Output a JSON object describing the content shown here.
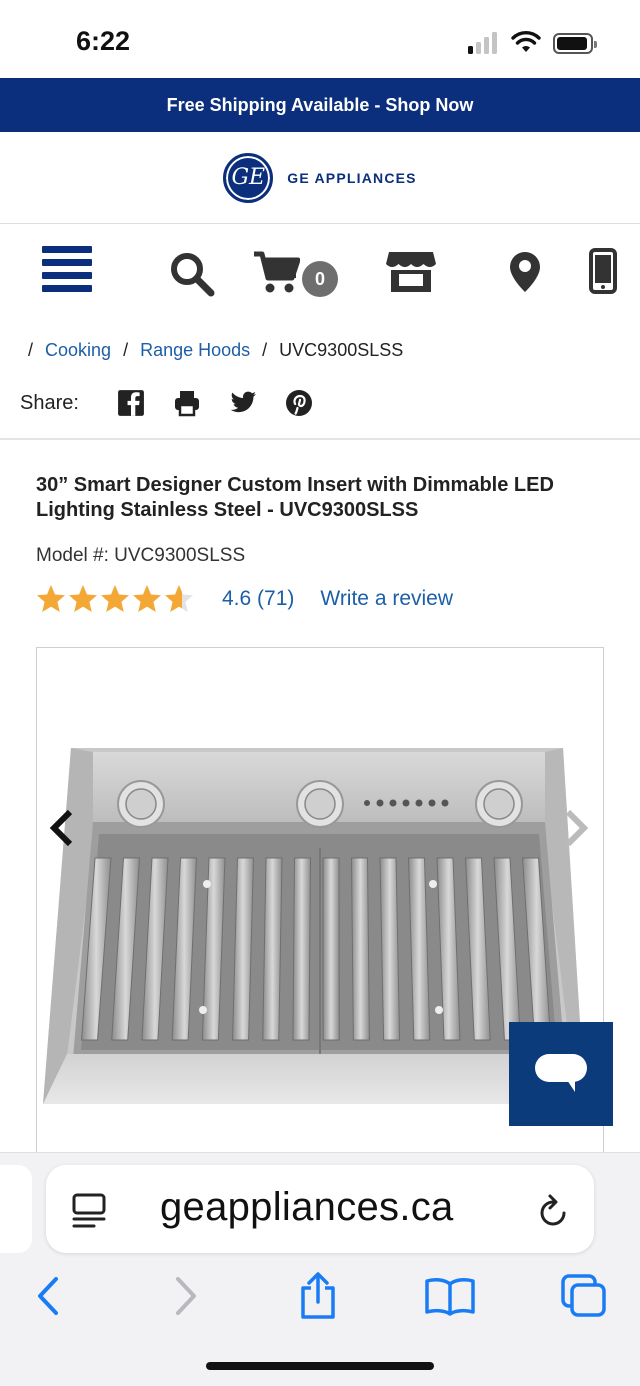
{
  "status_bar": {
    "time": "6:22"
  },
  "promo": {
    "text": "Free Shipping Available - Shop Now"
  },
  "brand": {
    "logo_text": "GE",
    "name": "GE APPLIANCES"
  },
  "nav": {
    "cart_count": "0"
  },
  "breadcrumb": {
    "sep": "/",
    "items": [
      {
        "label": "Cooking"
      },
      {
        "label": "Range Hoods"
      },
      {
        "label": "UVC9300SLSS"
      }
    ]
  },
  "share": {
    "label": "Share:"
  },
  "product": {
    "title": "30” Smart Designer Custom Insert with Dimmable LED Lighting Stainless Steel - UVC9300SLSS",
    "model": "Model #: UVC9300SLSS",
    "rating_value": "4.6 (71)",
    "rating": 4.6,
    "write_review": "Write a review"
  },
  "browser": {
    "url": "geappliances.ca"
  },
  "colors": {
    "brand_blue": "#0b2f7c",
    "link_blue": "#1d5ea8",
    "star": "#f3a734",
    "chat": "#0b3b7b",
    "ios_blue": "#1a7cf5"
  }
}
